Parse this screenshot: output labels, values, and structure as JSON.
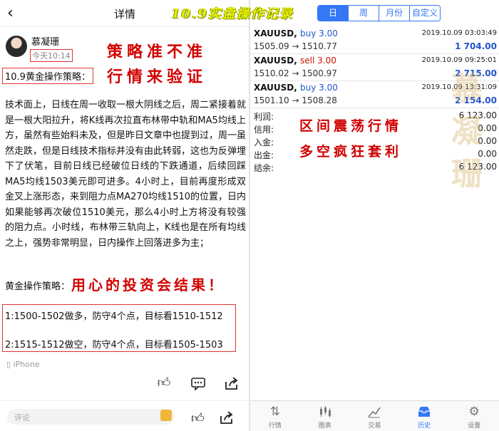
{
  "header": {
    "back_icon": "chevron-left-icon",
    "title": "详情",
    "banner": "10.9实盘操作记录"
  },
  "post": {
    "author": "慕凝珊",
    "time": "今天10:14",
    "callout1": "策略准不准",
    "callout2": "行情来验证",
    "topic": "10.9黄金操作策略：",
    "body": "技术面上，日线在周一收取一根大阴线之后，周二紧接着就是一根大阳拉升，将K线再次拉直布林带中轨和MA5均线上方，虽然有些始料未及，但是昨日文章中也提到过，周一虽然走跌，但是日线技术指标并没有由此转弱，这也为反弹埋下了伏笔，目前日线已经破位日线的下跌通道，后续回踩MA5均线1503美元即可进多。4小时上，目前再度形成双金叉上涨形态，来到阻力点MA270均线1510的位置，日内如果能够再次破位1510美元，那么4小时上方将没有较强的阻力点。小时线，布林带三轨向上，K线也是在所有均线之上，强势非常明显，日内操作上回落进多为主；",
    "strategy_label": "黄金操作策略：",
    "callout3": "用心的投资会结果！",
    "plan1": "1:1500-1502做多，防守4个点，目标看1510-1512",
    "plan2": "2:1515-1512做空，防守4个点，目标看1505-1503",
    "device": "iPhone",
    "comment_placeholder": "评论"
  },
  "segments": [
    {
      "label": "日",
      "active": true
    },
    {
      "label": "周",
      "active": false
    },
    {
      "label": "月份",
      "active": false
    },
    {
      "label": "自定义",
      "active": false
    }
  ],
  "trades": [
    {
      "symbol": "XAUUSD,",
      "side": "buy 3.00",
      "type": "buy",
      "date": "2019.10.09 03:03:49",
      "prices": "1505.09 → 1510.77",
      "profit": "1 704.00"
    },
    {
      "symbol": "XAUUSD,",
      "side": "sell 3.00",
      "type": "sell",
      "date": "2019.10.09 09:25:01",
      "prices": "1510.02 → 1500.97",
      "profit": "2 715.00"
    },
    {
      "symbol": "XAUUSD,",
      "side": "buy 3.00",
      "type": "buy",
      "date": "2019.10.09 13:31:09",
      "prices": "1501.10 → 1508.28",
      "profit": "2 154.00"
    }
  ],
  "summary": [
    {
      "label": "利润:",
      "value": "6 123.00"
    },
    {
      "label": "信用:",
      "value": "0.00"
    },
    {
      "label": "入金:",
      "value": "0.00"
    },
    {
      "label": "出金:",
      "value": "0.00"
    },
    {
      "label": "结余:",
      "value": "6 123.00"
    }
  ],
  "callout4": "区间震荡行情",
  "callout5": "多空疯狂套利",
  "watermark": "慕凝珊",
  "tabs": [
    {
      "label": "行情",
      "icon": "quotes-icon",
      "active": false
    },
    {
      "label": "图表",
      "icon": "chart-icon",
      "active": false
    },
    {
      "label": "交易",
      "icon": "trade-icon",
      "active": false
    },
    {
      "label": "历史",
      "icon": "history-icon",
      "active": true
    },
    {
      "label": "设置",
      "icon": "settings-icon",
      "active": false
    }
  ],
  "colors": {
    "accent": "#3478f6",
    "buy": "#2255cc",
    "sell": "#cc1100",
    "callout": "#d10000"
  }
}
